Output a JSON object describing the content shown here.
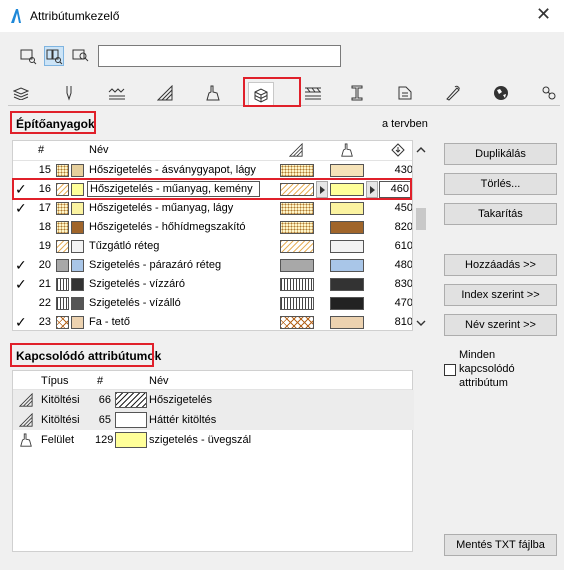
{
  "window": {
    "title": "Attribútumkezelő"
  },
  "search": {
    "value": ""
  },
  "section1": {
    "title": "Építőanyagok",
    "in_plan_label": "a tervben"
  },
  "list": {
    "headers": {
      "num": "#",
      "name": "Név"
    },
    "rows": [
      {
        "checked": false,
        "num": "15",
        "name": "Hőszigetelés - ásványgyapot, lágy",
        "fill": "dots",
        "surface": "#f6e3b8",
        "value": "430",
        "sw1": "dots",
        "sw2": "#e6cf9c",
        "selected": false
      },
      {
        "checked": true,
        "num": "16",
        "name": "Hőszigetelés - műanyag, kemény",
        "fill": "diag",
        "surface": "#ffff99",
        "value": "460",
        "sw1": "diag",
        "sw2": "#ffff99",
        "selected": true
      },
      {
        "checked": true,
        "num": "17",
        "name": "Hőszigetelés - műanyag, lágy",
        "fill": "dots",
        "surface": "#fbf3a0",
        "value": "450",
        "sw1": "dots",
        "sw2": "#fbf3a0",
        "selected": false
      },
      {
        "checked": false,
        "num": "18",
        "name": "Hőszigetelés - hőhídmegszakító",
        "fill": "dots",
        "surface": "#a0652a",
        "value": "820",
        "sw1": "dots",
        "sw2": "#a0652a",
        "selected": false
      },
      {
        "checked": false,
        "num": "19",
        "name": "Tűzgátló réteg",
        "fill": "diag",
        "surface": "#f3f3f3",
        "value": "610",
        "sw1": "diag",
        "sw2": "#f3f3f3",
        "selected": false
      },
      {
        "checked": true,
        "num": "20",
        "name": "Szigetelés - párazáró réteg",
        "fill": "grey",
        "surface": "#a9c6e8",
        "value": "480",
        "sw1": "grey",
        "sw2": "#a9c6e8",
        "selected": false
      },
      {
        "checked": true,
        "num": "21",
        "name": "Szigetelés - vízzáró",
        "fill": "vert",
        "surface": "#333333",
        "value": "830",
        "sw1": "vert",
        "sw2": "#333333",
        "selected": false
      },
      {
        "checked": false,
        "num": "22",
        "name": "Szigetelés - vízálló",
        "fill": "vert",
        "surface": "#222222",
        "value": "470",
        "sw1": "vert",
        "sw2": "#555555",
        "selected": false
      },
      {
        "checked": true,
        "num": "23",
        "name": "Fa - tető",
        "fill": "cross",
        "surface": "#ecd2b0",
        "value": "810",
        "sw1": "cross",
        "sw2": "#ecd2b0",
        "selected": false
      }
    ]
  },
  "buttons": {
    "duplicate": "Duplikálás",
    "delete": "Törlés...",
    "purge": "Takarítás",
    "add": "Hozzáadás >>",
    "by_index": "Index szerint >>",
    "by_name": "Név szerint >>",
    "save_txt": "Mentés TXT fájlba"
  },
  "section2": {
    "title": "Kapcsolódó attribútumok"
  },
  "related": {
    "headers": {
      "type": "Típus",
      "num": "#",
      "name": "Név"
    },
    "rows": [
      {
        "icon": "fill-icon",
        "type": "Kitöltési",
        "num": "66",
        "swatch": "diag-dark",
        "name": "Hőszigetelés"
      },
      {
        "icon": "fill-icon",
        "type": "Kitöltési",
        "num": "65",
        "swatch": "#ffffff",
        "name": "Háttér kitöltés"
      },
      {
        "icon": "paint-bucket-icon",
        "type": "Felület",
        "num": "129",
        "swatch": "#ffff99",
        "name": "szigetelés - üvegszál"
      }
    ]
  },
  "all_related": {
    "label": "Minden kapcsolódó attribútum",
    "checked": false
  }
}
